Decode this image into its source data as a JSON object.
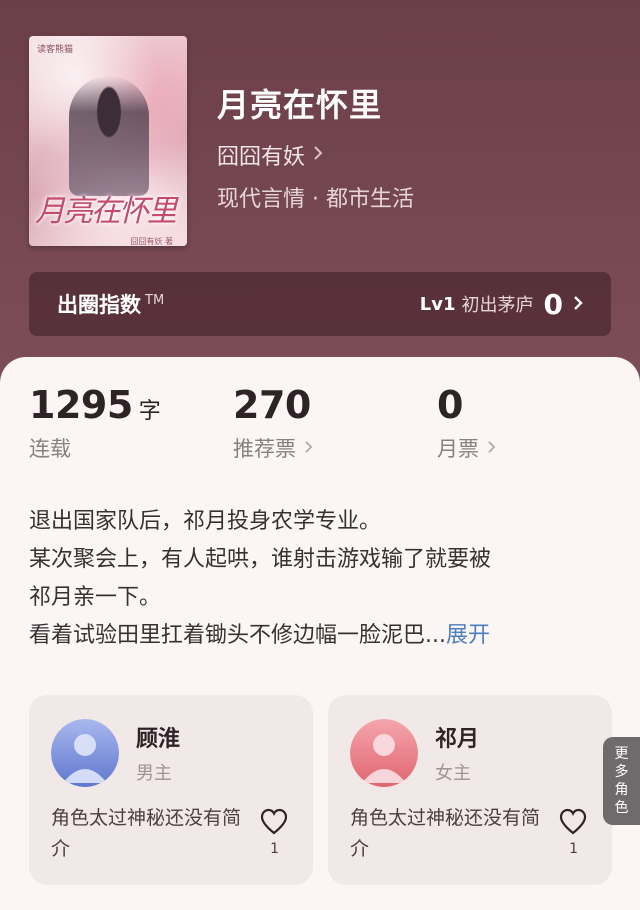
{
  "book": {
    "cover_publisher": "读客熊猫",
    "cover_title_art": "月亮在怀里",
    "cover_author_art": "囧囧有妖 著",
    "title": "月亮在怀里",
    "author": "囧囧有妖",
    "genre": "现代言情 · 都市生活"
  },
  "index_bar": {
    "title": "出圈指数",
    "tm": "TM",
    "level": "Lv1",
    "level_name": "初出茅庐",
    "value": "0"
  },
  "stats": [
    {
      "num": "1295",
      "unit": "字",
      "label": "连载",
      "has_chevron": false
    },
    {
      "num": "270",
      "unit": "",
      "label": "推荐票",
      "has_chevron": true
    },
    {
      "num": "0",
      "unit": "",
      "label": "月票",
      "has_chevron": true
    }
  ],
  "synopsis": {
    "line1": "退出国家队后，祁月投身农学专业。",
    "line2": "某次聚会上，有人起哄，谁射击游戏输了就要被",
    "line3": "祁月亲一下。",
    "line4": "看着试验田里扛着锄头不修边幅一脸泥巴...",
    "expand": "展开"
  },
  "characters": [
    {
      "name": "顾淮",
      "role": "男主",
      "desc": "角色太过神秘还没有简介",
      "likes": "1",
      "avatar_color": "#7b92d8"
    },
    {
      "name": "祁月",
      "role": "女主",
      "desc": "角色太过神秘还没有简介",
      "likes": "1",
      "avatar_color": "#e57a85"
    }
  ],
  "more_tab": {
    "label_chars": [
      "更",
      "多",
      "角",
      "色"
    ]
  },
  "icons": {
    "chevron": "chevron-right-icon",
    "heart": "heart-outline-icon"
  }
}
